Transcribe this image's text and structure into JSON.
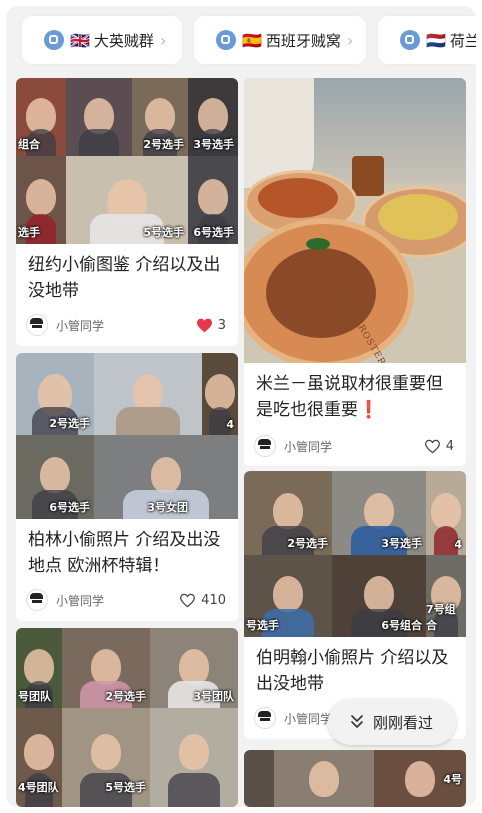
{
  "tags": [
    {
      "flag": "🇬🇧",
      "label": "大英贼群"
    },
    {
      "flag": "🇪🇸",
      "label": "西班牙贼窝"
    },
    {
      "flag": "🇳🇱",
      "label": "荷兰"
    }
  ],
  "posts": [
    {
      "title": "纽约小偷图鉴 介绍以及出没地带",
      "author": "小管同学",
      "likes": "3",
      "liked": true,
      "labels": [
        "组合",
        "2号选手",
        "3号选手",
        "选手",
        "5号选手",
        "6号选手"
      ]
    },
    {
      "title": "米兰－虽说取材很重要但是吃也很重要❗️",
      "author": "小管同学",
      "likes": "4",
      "liked": false,
      "image_text": "ALLA CROSTERIA DE"
    },
    {
      "title": "柏林小偷照片 介绍及出没地点 欧洲杯特辑！",
      "author": "小管同学",
      "likes": "410",
      "liked": false,
      "labels": [
        "2号选手",
        "4",
        "6号选手",
        "3号女团"
      ]
    },
    {
      "title": "伯明翰小偷照片 介绍以及出没地带",
      "author": "小管同学",
      "likes": "",
      "labels": [
        "2号选手",
        "3号选手",
        "4",
        "号选手",
        "6号组合",
        "7号组合"
      ]
    },
    {
      "labels": [
        "号团队",
        "2号选手",
        "3号团队",
        "4号团队",
        "5号选手"
      ]
    },
    {
      "labels": [
        "4号"
      ]
    }
  ],
  "floating_button": {
    "label": "刚刚看过",
    "icon": "double-chevron-down-icon"
  },
  "colors": {
    "heart_active": "#e8374a",
    "tag_icon": "#6a9bd7"
  }
}
